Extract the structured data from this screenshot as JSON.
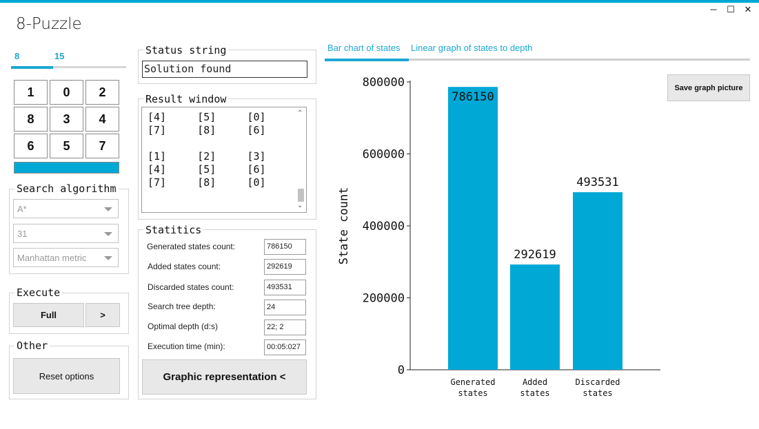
{
  "window": {
    "title": "8-Puzzle",
    "controls": {
      "minimize": "─",
      "maximize": "☐",
      "close": "✕"
    }
  },
  "puzzle": {
    "size_tabs": [
      "8",
      "15"
    ],
    "active_tab": "8",
    "tiles": [
      "1",
      "0",
      "2",
      "8",
      "3",
      "4",
      "6",
      "5",
      "7"
    ],
    "progress": 1.0
  },
  "search": {
    "legend": "Search algorithm",
    "algorithm": "A*",
    "depth_limit": "31",
    "heuristic": "Manhattan metric"
  },
  "execute": {
    "legend": "Execute",
    "full_label": "Full",
    "step_label": ">"
  },
  "other": {
    "legend": "Other",
    "reset_label": "Reset options"
  },
  "status": {
    "legend": "Status string",
    "value": "Solution found"
  },
  "result": {
    "legend": "Result window",
    "lines": [
      "[4]     [5]     [0]",
      "[7]     [8]     [6]",
      "",
      "[1]     [2]     [3]",
      "[4]     [5]     [6]",
      "[7]     [8]     [0]"
    ]
  },
  "statistics": {
    "legend": "Statitics",
    "rows": [
      {
        "label": "Generated states count:",
        "value": "786150"
      },
      {
        "label": "Added states count:",
        "value": "292619"
      },
      {
        "label": "Discarded states count:",
        "value": "493531"
      },
      {
        "label": "Search tree depth:",
        "value": "24"
      },
      {
        "label": "Optimal depth (d:s)",
        "value": "22; 2"
      },
      {
        "label": "Execution time (min):",
        "value": "00:05:027"
      }
    ],
    "graphic_label": "Graphic representation <"
  },
  "chart_tabs": {
    "items": [
      "Bar chart of states",
      "Linear graph of states to depth"
    ],
    "active": "Bar chart of states"
  },
  "save_label": "Save graph picture",
  "colors": {
    "accent": "#00a8d6",
    "bar": "#00a8d6"
  },
  "chart_data": {
    "type": "bar",
    "categories": [
      "Generated states",
      "Added states",
      "Discarded states"
    ],
    "values": [
      786150,
      292619,
      493531
    ],
    "ylabel": "State count",
    "ylim": [
      0,
      800000
    ],
    "yticks": [
      0,
      200000,
      400000,
      600000,
      800000
    ],
    "grid": false
  }
}
